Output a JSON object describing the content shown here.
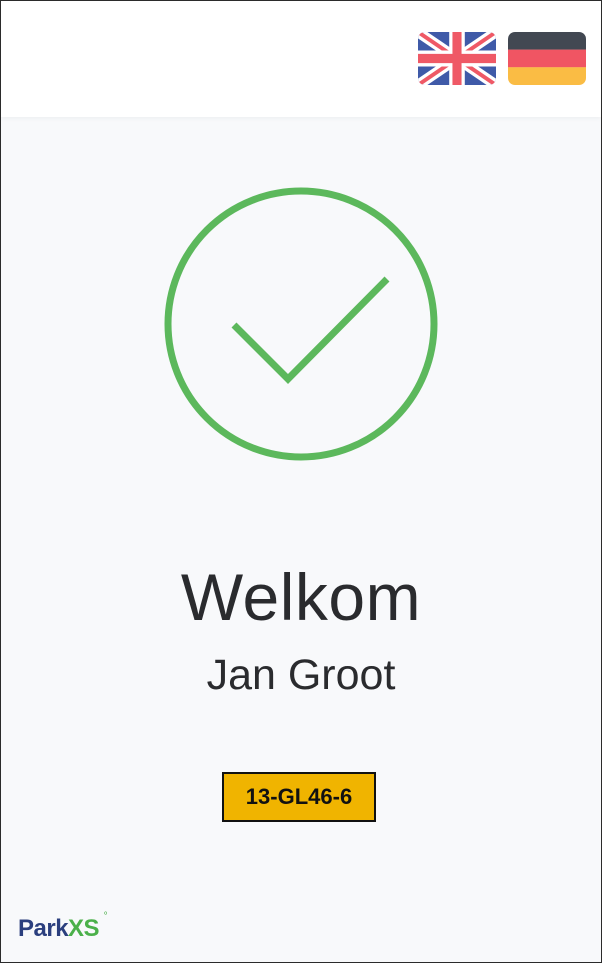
{
  "header": {
    "languages": [
      {
        "code": "en",
        "icon": "uk-flag-icon"
      },
      {
        "code": "de",
        "icon": "german-flag-icon"
      }
    ]
  },
  "status": {
    "icon": "check-circle-icon",
    "color": "#5cb85c"
  },
  "greeting": {
    "title": "Welkom",
    "name": "Jan Groot"
  },
  "vehicle": {
    "plate": "13-GL46-6",
    "plate_color": "#f0b400"
  },
  "brand": {
    "logo_part1": "Park",
    "logo_part2": "XS",
    "logo_mark": "°"
  }
}
